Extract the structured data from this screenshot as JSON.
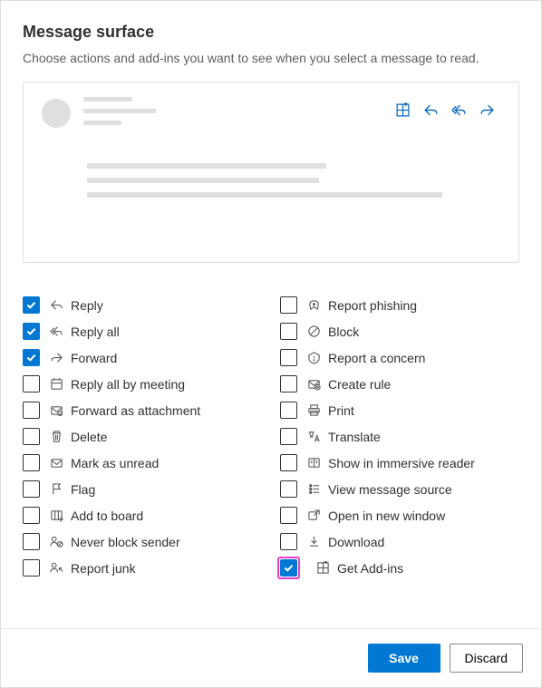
{
  "header": {
    "title": "Message surface",
    "subtitle": "Choose actions and add-ins you want to see when you select a message to read."
  },
  "columns": [
    [
      {
        "icon": "reply",
        "label": "Reply",
        "checked": true,
        "highlight": false
      },
      {
        "icon": "reply-all",
        "label": "Reply all",
        "checked": true,
        "highlight": false
      },
      {
        "icon": "forward",
        "label": "Forward",
        "checked": true,
        "highlight": false
      },
      {
        "icon": "meeting",
        "label": "Reply all by meeting",
        "checked": false,
        "highlight": false
      },
      {
        "icon": "attachment",
        "label": "Forward as attachment",
        "checked": false,
        "highlight": false
      },
      {
        "icon": "delete",
        "label": "Delete",
        "checked": false,
        "highlight": false
      },
      {
        "icon": "unread",
        "label": "Mark as unread",
        "checked": false,
        "highlight": false
      },
      {
        "icon": "flag",
        "label": "Flag",
        "checked": false,
        "highlight": false
      },
      {
        "icon": "board",
        "label": "Add to board",
        "checked": false,
        "highlight": false
      },
      {
        "icon": "never-block",
        "label": "Never block sender",
        "checked": false,
        "highlight": false
      },
      {
        "icon": "report-junk",
        "label": "Report junk",
        "checked": false,
        "highlight": false
      }
    ],
    [
      {
        "icon": "phishing",
        "label": "Report phishing",
        "checked": false,
        "highlight": false
      },
      {
        "icon": "block",
        "label": "Block",
        "checked": false,
        "highlight": false
      },
      {
        "icon": "concern",
        "label": "Report a concern",
        "checked": false,
        "highlight": false
      },
      {
        "icon": "rule",
        "label": "Create rule",
        "checked": false,
        "highlight": false
      },
      {
        "icon": "print",
        "label": "Print",
        "checked": false,
        "highlight": false
      },
      {
        "icon": "translate",
        "label": "Translate",
        "checked": false,
        "highlight": false
      },
      {
        "icon": "immersive",
        "label": "Show in immersive reader",
        "checked": false,
        "highlight": false
      },
      {
        "icon": "source",
        "label": "View message source",
        "checked": false,
        "highlight": false
      },
      {
        "icon": "new-window",
        "label": "Open in new window",
        "checked": false,
        "highlight": false
      },
      {
        "icon": "download",
        "label": "Download",
        "checked": false,
        "highlight": false
      },
      {
        "icon": "addins",
        "label": "Get Add-ins",
        "checked": true,
        "highlight": true
      }
    ]
  ],
  "footer": {
    "save": "Save",
    "discard": "Discard"
  }
}
